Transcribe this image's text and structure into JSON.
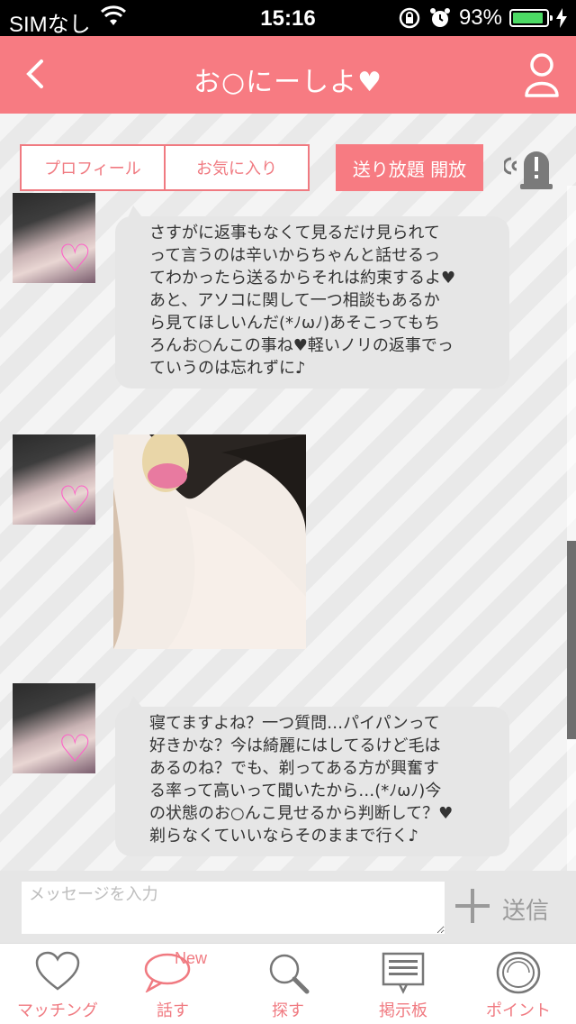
{
  "status_bar": {
    "carrier": "SIMなし",
    "time": "15:16",
    "battery": "93%",
    "battery_level": 0.93
  },
  "nav": {
    "title": "お○にーしよ♥"
  },
  "actions": {
    "profile_label": "プロフィール",
    "favorite_label": "お気に入り",
    "unlimited_label": "送り放題 開放"
  },
  "messages": [
    {
      "lines": [
        "さすがに返事もなくて見るだけ見られて",
        "って言うのは辛いからちゃんと話せるっ",
        "てわかったら送るからそれは約束するよ♥",
        "あと、アソコに関して一つ相談もあるか",
        "ら見てほしいんだ(*ﾉωﾉ)あそこってもち",
        "ろんお○んこの事ね♥軽いノリの返事でっ",
        "ていうのは忘れずに♪"
      ]
    },
    {
      "lines": [
        "寝てますよね？一つ質問…パイパンって",
        "好きかな？今は綺麗にはしてるけど毛は",
        "あるのね？でも、剃ってある方が興奮す",
        "る率って高いって聞いたから…(*ﾉωﾉ)今",
        "の状態のお○んこ見せるから判断して？♥",
        "剃らなくていいならそのままで行く♪"
      ]
    }
  ],
  "input": {
    "placeholder": "メッセージを入力",
    "send_label": "送信"
  },
  "tabs": [
    {
      "label": "マッチング",
      "icon": "heart-icon"
    },
    {
      "label": "話す",
      "icon": "speech-bubble-icon",
      "badge": "New"
    },
    {
      "label": "探す",
      "icon": "magnifier-icon"
    },
    {
      "label": "掲示板",
      "icon": "board-icon"
    },
    {
      "label": "ポイント",
      "icon": "coin-icon"
    }
  ],
  "colors": {
    "accent": "#f77b82",
    "accent_text": "#f07a81",
    "bubble": "#e6e6e6"
  }
}
